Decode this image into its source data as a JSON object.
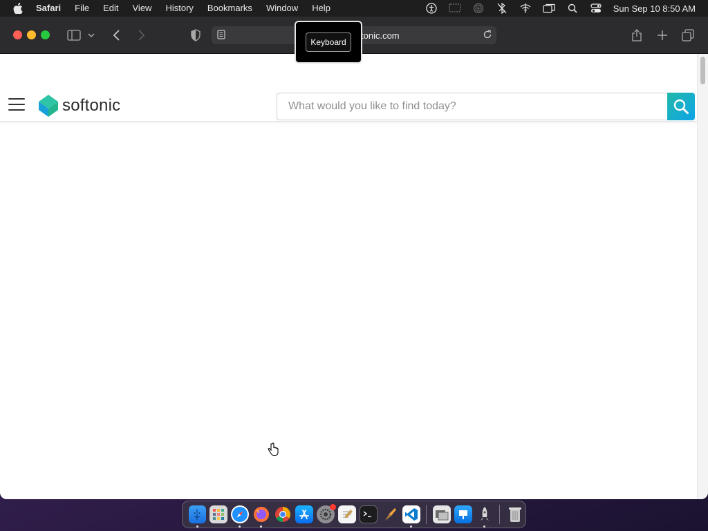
{
  "menubar": {
    "app_name": "Safari",
    "items": [
      "File",
      "Edit",
      "View",
      "History",
      "Bookmarks",
      "Window",
      "Help"
    ],
    "clock": "Sun Sep 10  8:50 AM"
  },
  "browser": {
    "url_visible": "tonic.com",
    "tooltip": "Keyboard"
  },
  "site": {
    "logo_text": "softonic",
    "search": {
      "placeholder": "What would you like to find today?",
      "value": ""
    }
  },
  "dock": {
    "apps": [
      "finder-icon",
      "launchpad-icon",
      "safari-icon",
      "firefox-icon",
      "chrome-icon",
      "app-store-icon",
      "system-settings-icon",
      "textedit-icon",
      "terminal-icon",
      "pixelmator-icon",
      "vscode-icon",
      "preview-icon",
      "keynote-icon",
      "rocket-icon",
      "trash-icon"
    ]
  },
  "colors": {
    "brand_green": "#22b8a8",
    "brand_blue": "#0ea5e9",
    "menubar_bg": "#1e1e1e",
    "toolbar_bg": "#2c2c2e"
  }
}
